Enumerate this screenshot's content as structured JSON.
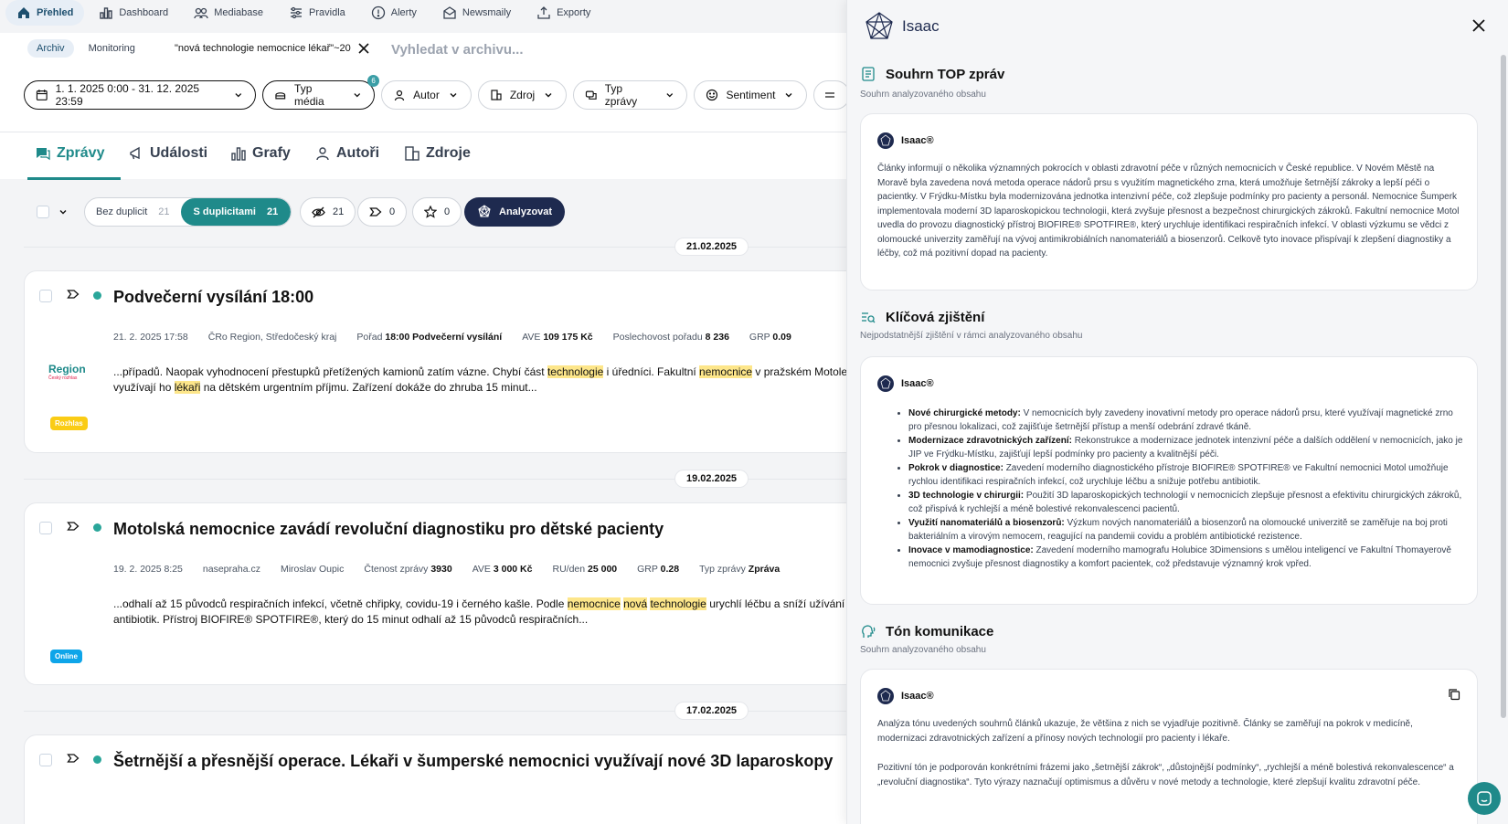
{
  "nav": {
    "items": [
      {
        "label": "Přehled",
        "icon": "home-icon"
      },
      {
        "label": "Dashboard",
        "icon": "bar-chart-icon"
      },
      {
        "label": "Mediabase",
        "icon": "users-icon"
      },
      {
        "label": "Pravidla",
        "icon": "sliders-icon"
      },
      {
        "label": "Alerty",
        "icon": "alert-icon"
      },
      {
        "label": "Newsmaily",
        "icon": "mail-icon"
      },
      {
        "label": "Exporty",
        "icon": "export-icon"
      }
    ]
  },
  "search": {
    "mode_archive": "Archiv",
    "mode_monitoring": "Monitoring",
    "query_chip": "\"nová technologie nemocnice lékař\"~20",
    "placeholder": "Vyhledat v archivu..."
  },
  "filters": {
    "date_range": "1. 1. 2025 0:00 - 31. 12. 2025 23:59",
    "media_type": "Typ média",
    "media_type_badge": "6",
    "author": "Autor",
    "source": "Zdroj",
    "message_type": "Typ zprávy",
    "sentiment": "Sentiment"
  },
  "tabs": [
    "Zprávy",
    "Události",
    "Grafy",
    "Autoři",
    "Zdroje"
  ],
  "toolbar": {
    "no_duplicates": "Bez duplicit",
    "no_duplicates_count": "21",
    "with_duplicates": "S duplicitami",
    "with_duplicates_count": "21",
    "hidden_count": "21",
    "tag_count": "0",
    "star_count": "0",
    "analyze": "Analyzovat"
  },
  "articles": [
    {
      "date_group": "21.02.2025",
      "title": "Podvečerní vysílání 18:00",
      "meta": {
        "datetime": "21. 2. 2025 17:58",
        "source": "ČRo Region, Středočeský kraj",
        "show_label": "Pořad",
        "show": "18:00 Podvečerní vysílání",
        "ave_label": "AVE",
        "ave": "109 175 Kč",
        "reach_label": "Poslechovost pořadu",
        "reach": "8 236",
        "grp_label": "GRP",
        "grp": "0.09"
      },
      "snippet": {
        "p1": "...případů. Naopak vyhodnocení přestupků přetížených kamionů zatím vázne. Chybí část ",
        "h1": "technologie",
        "p2": " i úředníci. Fakultní ",
        "h2": "nemocnice",
        "p3": " v pražském Motole využívají ho ",
        "h3": "lékaři",
        "p4": " na dětském urgentním příjmu. Zařízení dokáže do zhruba 15 minut..."
      },
      "logo": {
        "name": "Region",
        "sub": "Český rozhlas"
      },
      "type_chip": "Rozhlas"
    },
    {
      "date_group": "19.02.2025",
      "title": "Motolská nemocnice zavádí revoluční diagnostiku pro dětské pacienty",
      "meta": {
        "datetime": "19. 2. 2025 8:25",
        "source": "nasepraha.cz",
        "author": "Miroslav Oupic",
        "reads_label": "Čtenost zprávy",
        "reads": "3930",
        "ave_label": "AVE",
        "ave": "3 000 Kč",
        "ru_label": "RU/den",
        "ru": "25 000",
        "grp_label": "GRP",
        "grp": "0.28",
        "type_label": "Typ zprávy",
        "type": "Zpráva"
      },
      "snippet": {
        "p1": "...odhalí až 15 původců respiračních infekcí, včetně chřipky, covidu-19 i černého kašle. Podle ",
        "h1": "nemocnice",
        "p2": " ",
        "h2": "nová",
        "p3": " ",
        "h3": "technologie",
        "p4": " urychlí léčbu a sníží užívání antibiotik. Přístroj BIOFIRE® SPOTFIRE®, který do 15 minut odhalí až 15 původců respiračních..."
      },
      "type_chip": "Online"
    },
    {
      "date_group": "17.02.2025",
      "title": "Šetrnější a přesnější operace. Lékaři v šumperské nemocnici využívají nové 3D laparoskopy"
    }
  ],
  "panel": {
    "title": "Isaac",
    "bot_name": "Isaac®",
    "summary": {
      "title": "Souhrn TOP zpráv",
      "subtitle": "Souhrn analyzovaného obsahu",
      "text": "Články informují o několika významných pokrocích v oblasti zdravotní péče v různých nemocnicích v České republice. V Novém Městě na Moravě byla zavedena nová metoda operace nádorů prsu s využitím magnetického zrna, která umožňuje šetrnější zákroky a lepší péči o pacientky. V Frýdku-Místku byla modernizována jednotka intenzivní péče, což zlepšuje podmínky pro pacienty a personál. Nemocnice Šumperk implementovala moderní 3D laparoskopickou technologii, která zvyšuje přesnost a bezpečnost chirurgických zákroků. Fakultní nemocnice Motol uvedla do provozu diagnostický přístroj BIOFIRE® SPOTFIRE®, který urychluje identifikaci respiračních infekcí. V oblasti výzkumu se vědci z olomoucké univerzity zaměřují na vývoj antimikrobiálních nanomateriálů a biosenzorů. Celkově tyto inovace přispívají k zlepšení diagnostiky a léčby, což má pozitivní dopad na pacienty."
    },
    "findings": {
      "title": "Klíčová zjištění",
      "subtitle": "Nejpodstatnější zjištění v rámci analyzovaného obsahu",
      "items": [
        {
          "head": "Nové chirurgické metody:",
          "text": " V nemocnicích byly zavedeny inovativní metody pro operace nádorů prsu, které využívají magnetické zrno pro přesnou lokalizaci, což zajišťuje šetrnější přístup a menší odebrání zdravé tkáně."
        },
        {
          "head": "Modernizace zdravotnických zařízení:",
          "text": " Rekonstrukce a modernizace jednotek intenzivní péče a dalších oddělení v nemocnicích, jako je JIP ve Frýdku-Místku, zajišťují lepší podmínky pro pacienty a kvalitnější péči."
        },
        {
          "head": "Pokrok v diagnostice:",
          "text": " Zavedení moderního diagnostického přístroje BIOFIRE® SPOTFIRE® ve Fakultní nemocnici Motol umožňuje rychlou identifikaci respiračních infekcí, což urychluje léčbu a snižuje potřebu antibiotik."
        },
        {
          "head": "3D technologie v chirurgii:",
          "text": " Použití 3D laparoskopických technologií v nemocnicích zlepšuje přesnost a efektivitu chirurgických zákroků, což přispívá k rychlejší a méně bolestivé rekonvalescenci pacientů."
        },
        {
          "head": "Využití nanomateriálů a biosenzorů:",
          "text": " Výzkum nových nanomateriálů a biosenzorů na olomoucké univerzitě se zaměřuje na boj proti bakteriálním a virovým nemocem, reagující na pandemii covidu a problém antibiotické rezistence."
        },
        {
          "head": "Inovace v mamodiagnostice:",
          "text": " Zavedení moderního mamografu Holubice 3Dimensions s umělou inteligencí ve Fakultní Thomayerově nemocnici zvyšuje přesnost diagnostiky a komfort pacientek, což představuje významný krok vpřed."
        }
      ]
    },
    "tone": {
      "title": "Tón komunikace",
      "subtitle": "Souhrn analyzovaného obsahu",
      "p1": "Analýza tónu uvedených souhrnů článků ukazuje, že většina z nich se vyjadřuje pozitivně. Články se zaměřují na pokrok v medicíně, modernizaci zdravotnických zařízení a přínosy nových technologií pro pacienty i lékaře.",
      "p2": "Pozitivní tón je podporován konkrétními frázemi jako „šetrnější zákrok“, „důstojnější podmínky“, „rychlejší a méně bolestivá rekonvalescence“ a „revoluční diagnostika“. Tyto výrazy naznačují optimismus a důvěru v nové metody a technologie, které zlepšují kvalitu zdravotní péče."
    }
  }
}
